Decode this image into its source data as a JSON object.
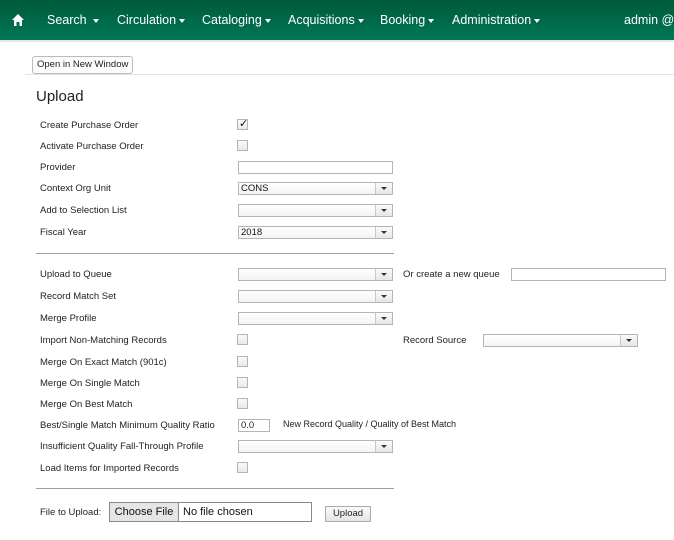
{
  "navbar": {
    "home_icon": "home-icon",
    "items": [
      {
        "label": "Search"
      },
      {
        "label": "Circulation"
      },
      {
        "label": "Cataloging"
      },
      {
        "label": "Acquisitions"
      },
      {
        "label": "Booking"
      },
      {
        "label": "Administration"
      }
    ],
    "user": "admin @ "
  },
  "toolbar": {
    "open_new_window_label": "Open in New Window"
  },
  "page": {
    "title": "Upload"
  },
  "form": {
    "create_po": {
      "label": "Create Purchase Order",
      "checked": true
    },
    "activate_po": {
      "label": "Activate Purchase Order",
      "checked": false
    },
    "provider": {
      "label": "Provider",
      "value": ""
    },
    "context_org_unit": {
      "label": "Context Org Unit",
      "value": "CONS"
    },
    "selection_list": {
      "label": "Add to Selection List",
      "value": ""
    },
    "fiscal_year": {
      "label": "Fiscal Year",
      "value": "2018"
    },
    "upload_queue": {
      "label": "Upload to Queue",
      "value": ""
    },
    "new_queue": {
      "label": "Or create a new queue",
      "value": ""
    },
    "record_match_set": {
      "label": "Record Match Set",
      "value": ""
    },
    "merge_profile": {
      "label": "Merge Profile",
      "value": ""
    },
    "import_non_matching": {
      "label": "Import Non-Matching Records",
      "checked": false
    },
    "record_source": {
      "label": "Record Source",
      "value": ""
    },
    "merge_exact": {
      "label": "Merge On Exact Match (901c)",
      "checked": false
    },
    "merge_single": {
      "label": "Merge On Single Match",
      "checked": false
    },
    "merge_best": {
      "label": "Merge On Best Match",
      "checked": false
    },
    "min_quality_ratio": {
      "label": "Best/Single Match Minimum Quality Ratio",
      "value": "0.0",
      "hint": "New Record Quality / Quality of Best Match"
    },
    "fallthrough_profile": {
      "label": "Insufficient Quality Fall-Through Profile",
      "value": ""
    },
    "load_items": {
      "label": "Load Items for Imported Records",
      "checked": false
    },
    "file": {
      "label": "File to Upload:",
      "choose_label": "Choose File",
      "status": "No file chosen"
    },
    "upload_button": "Upload"
  }
}
